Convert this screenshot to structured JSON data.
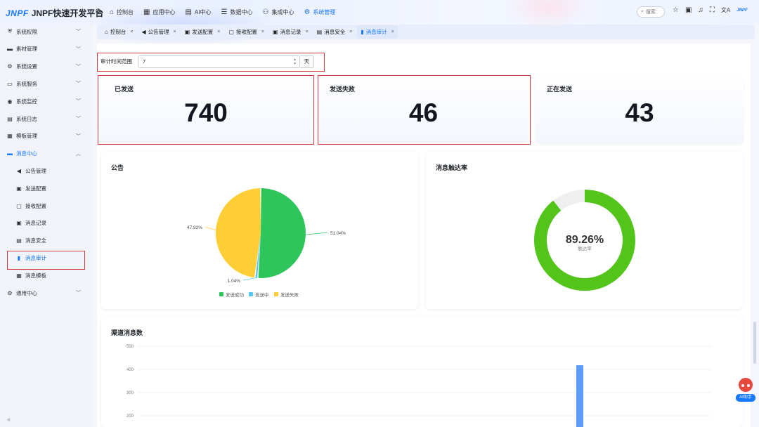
{
  "app": {
    "logo_mark": "JNPF",
    "title": "JNPF快速开发平台"
  },
  "topnav": [
    {
      "label": "控制台",
      "icon": "home-icon",
      "active": false
    },
    {
      "label": "应用中心",
      "icon": "apps-icon",
      "active": false
    },
    {
      "label": "AI中心",
      "icon": "ai-icon",
      "active": false
    },
    {
      "label": "数据中心",
      "icon": "database-icon",
      "active": false
    },
    {
      "label": "集成中心",
      "icon": "integration-icon",
      "active": false
    },
    {
      "label": "系统管理",
      "icon": "gear-icon",
      "active": true
    }
  ],
  "header": {
    "search_placeholder": "搜索",
    "brand_mini": "JNPF"
  },
  "sidebar": {
    "items": [
      {
        "label": "系统权限",
        "icon": "shield-icon",
        "expanded": false
      },
      {
        "label": "素材管理",
        "icon": "folder-icon",
        "expanded": false
      },
      {
        "label": "系统设置",
        "icon": "settings-icon",
        "expanded": false
      },
      {
        "label": "系统服务",
        "icon": "server-icon",
        "expanded": false
      },
      {
        "label": "系统监控",
        "icon": "monitor-icon",
        "expanded": false
      },
      {
        "label": "系统日志",
        "icon": "log-icon",
        "expanded": false
      },
      {
        "label": "模板管理",
        "icon": "template-icon",
        "expanded": false
      },
      {
        "label": "消息中心",
        "icon": "message-icon",
        "expanded": true
      }
    ],
    "sub_items": [
      {
        "label": "公告管理",
        "icon": "megaphone-icon"
      },
      {
        "label": "发送配置",
        "icon": "send-config-icon"
      },
      {
        "label": "接收配置",
        "icon": "receive-config-icon"
      },
      {
        "label": "消息记录",
        "icon": "record-icon"
      },
      {
        "label": "消息安全",
        "icon": "security-icon"
      },
      {
        "label": "消息审计",
        "icon": "audit-icon"
      },
      {
        "label": "消息模板",
        "icon": "msg-template-icon"
      }
    ],
    "footer_item": {
      "label": "通用中心",
      "icon": "common-icon"
    }
  },
  "tabs": [
    {
      "label": "控制台",
      "icon": "home-icon",
      "active": false
    },
    {
      "label": "公告管理",
      "icon": "megaphone-icon",
      "active": false
    },
    {
      "label": "发送配置",
      "icon": "send-config-icon",
      "active": false
    },
    {
      "label": "接收配置",
      "icon": "receive-config-icon",
      "active": false
    },
    {
      "label": "消息记录",
      "icon": "record-icon",
      "active": false
    },
    {
      "label": "消息安全",
      "icon": "security-icon",
      "active": false
    },
    {
      "label": "消息审计",
      "icon": "audit-icon",
      "active": true
    }
  ],
  "filter": {
    "label": "审计时间范围",
    "value": "7",
    "unit": "天"
  },
  "stats": [
    {
      "label": "已发送",
      "value": "740"
    },
    {
      "label": "发送失败",
      "value": "46"
    },
    {
      "label": "正在发送",
      "value": "43"
    }
  ],
  "panels": {
    "notice": {
      "title": "公告"
    },
    "reach": {
      "title": "消息触达率"
    },
    "channel": {
      "title": "渠道消息数"
    }
  },
  "ai_helper": {
    "label": "AI助手"
  },
  "colors": {
    "accent": "#1677ff",
    "green": "#2ec55a",
    "yellow": "#ffcd35",
    "cyan": "#56c6ef",
    "donut": "#52c41a",
    "bar": "#5b9dff"
  },
  "chart_data": [
    {
      "type": "pie",
      "title": "公告",
      "slices": [
        {
          "name": "发送成功",
          "value": 51.04,
          "label": "51.04%"
        },
        {
          "name": "发送中",
          "value": 1.04,
          "label": "1.04%"
        },
        {
          "name": "发送失败",
          "value": 47.92,
          "label": "47.92%"
        }
      ],
      "legend": "bottom"
    },
    {
      "type": "pie",
      "title": "消息触达率",
      "donut": true,
      "value": 89.26,
      "center_value": "89.26%",
      "center_label": "触达率"
    },
    {
      "type": "bar",
      "title": "渠道消息数",
      "ylim": [
        0,
        500
      ],
      "yticks": [
        200,
        300,
        400,
        500
      ],
      "categories": [
        "",
        "",
        "",
        "",
        "",
        "",
        "",
        "",
        "",
        "",
        "",
        "",
        "",
        "",
        "",
        "",
        "",
        "",
        "",
        "",
        "",
        "",
        "",
        ""
      ],
      "values": [
        0,
        0,
        0,
        0,
        0,
        0,
        0,
        0,
        0,
        0,
        0,
        0,
        0,
        0,
        0,
        0,
        0,
        0,
        418,
        0,
        0,
        0,
        0,
        0
      ],
      "grid": true
    }
  ]
}
